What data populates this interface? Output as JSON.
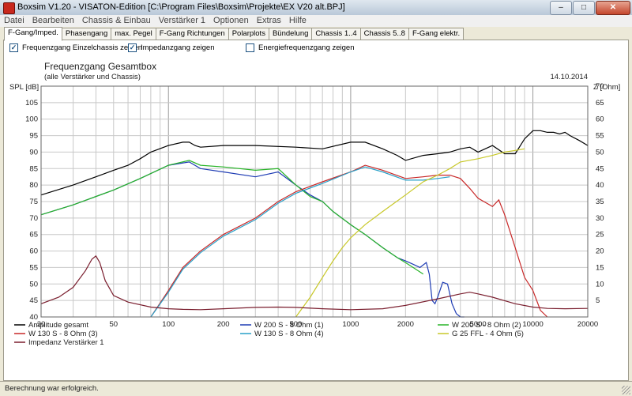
{
  "window": {
    "title": "Boxsim V1.20 - VISATON-Edition [C:\\Program Files\\Boxsim\\Projekte\\EX V20 alt.BPJ]",
    "minimize": "–",
    "maximize": "□",
    "close": "✕"
  },
  "menu": [
    "Datei",
    "Bearbeiten",
    "Chassis & Einbau",
    "Verstärker 1",
    "Optionen",
    "Extras",
    "Hilfe"
  ],
  "tabs": [
    {
      "label": "F-Gang/Imped.",
      "active": true
    },
    {
      "label": "Phasengang",
      "active": false
    },
    {
      "label": "max. Pegel",
      "active": false
    },
    {
      "label": "F-Gang Richtungen",
      "active": false
    },
    {
      "label": "Polarplots",
      "active": false
    },
    {
      "label": "Bündelung",
      "active": false
    },
    {
      "label": "Chassis 1..4",
      "active": false
    },
    {
      "label": "Chassis 5..8",
      "active": false
    },
    {
      "label": "F-Gang elektr.",
      "active": false
    }
  ],
  "checkboxes": [
    {
      "label": "Frequenzgang Einzelchassis zeigen",
      "checked": true
    },
    {
      "label": "Impedanzgang zeigen",
      "checked": true
    },
    {
      "label": "Energiefrequenzgang zeigen",
      "checked": false
    }
  ],
  "status": "Berechnung war erfolgreich.",
  "chart_data": {
    "type": "line",
    "title": "Frequenzgang Gesamtbox",
    "subtitle": "(alle Verstärker und Chassis)",
    "date": "14.10.2014",
    "ylabel": "SPL [dB]",
    "ylabel_right": "Z [Ohm]",
    "xscale": "log",
    "xlim": [
      20,
      20000
    ],
    "ylim": [
      40,
      110
    ],
    "ylim_right": [
      0,
      70
    ],
    "x_ticks": [
      20,
      50,
      100,
      200,
      500,
      1000,
      2000,
      5000,
      10000,
      20000
    ],
    "x_tick_labels": [
      "20",
      "50",
      "100",
      "200",
      "500",
      "1000",
      "2000",
      "5000",
      "10000",
      "20000"
    ],
    "y_ticks": [
      40,
      45,
      50,
      55,
      60,
      65,
      70,
      75,
      80,
      85,
      90,
      95,
      100,
      105,
      110
    ],
    "y_tick_labels": [
      "40",
      "45",
      "50",
      "55",
      "60",
      "65",
      "70",
      "75",
      "80",
      "85",
      "90",
      "95",
      "100",
      "105",
      ""
    ],
    "y_ticks_right": [
      5,
      10,
      15,
      20,
      25,
      30,
      35,
      40,
      45,
      50,
      55,
      60,
      65,
      70
    ],
    "y_tick_labels_right": [
      "5",
      "10",
      "15",
      "20",
      "25",
      "30",
      "35",
      "40",
      "45",
      "50",
      "55",
      "60",
      "65",
      "70"
    ],
    "grid": true,
    "legend_position": "bottom",
    "series": [
      {
        "name": "Amplitude gesamt",
        "color": "#000000",
        "axis": "left",
        "x": [
          20,
          30,
          40,
          50,
          60,
          70,
          80,
          100,
          120,
          130,
          140,
          150,
          200,
          300,
          500,
          700,
          1000,
          1200,
          1500,
          1800,
          2000,
          2500,
          3000,
          3500,
          4000,
          4500,
          5000,
          6000,
          7000,
          8000,
          9000,
          10000,
          11000,
          12000,
          13000,
          14000,
          15000,
          16000,
          18000,
          20000
        ],
        "y": [
          77,
          80,
          82.5,
          84.5,
          86,
          88,
          90,
          92,
          93,
          93,
          92,
          91.5,
          92,
          92,
          91.5,
          91,
          93,
          93,
          91,
          89,
          87.5,
          89,
          89.5,
          90,
          91,
          91.5,
          90,
          92,
          89.5,
          89.5,
          94,
          96.5,
          96.5,
          96,
          96,
          95.5,
          96,
          95,
          93.5,
          92
        ]
      },
      {
        "name": "W 200 S - 8 Ohm (1)",
        "color": "#1e3cb4",
        "axis": "left",
        "x": [
          20,
          30,
          50,
          70,
          100,
          130,
          150,
          200,
          300,
          400,
          500,
          600,
          700,
          800,
          1000,
          1200,
          1500,
          1800,
          2000,
          2200,
          2400,
          2600,
          2700,
          2800,
          2900,
          3000,
          3200,
          3400,
          3600,
          3800,
          4000,
          4200
        ],
        "y": [
          71,
          74,
          78.5,
          82,
          86,
          87,
          85,
          84,
          82.5,
          84,
          80,
          77,
          75,
          72,
          68,
          65,
          61,
          58,
          57,
          56,
          55,
          56.5,
          53,
          45,
          44,
          46,
          50.5,
          50,
          44,
          41,
          40,
          40
        ]
      },
      {
        "name": "W 200 S - 8 Ohm (2)",
        "color": "#28b428",
        "axis": "left",
        "x": [
          20,
          30,
          50,
          70,
          100,
          130,
          150,
          200,
          300,
          400,
          500,
          600,
          700,
          800,
          1000,
          1200,
          1500,
          1800,
          2000,
          2200,
          2500
        ],
        "y": [
          71,
          74,
          78.5,
          82,
          86,
          87.5,
          86,
          85.5,
          84.5,
          85,
          80,
          76.5,
          75,
          72,
          68,
          65,
          61,
          58,
          56.5,
          55,
          53
        ]
      },
      {
        "name": "W 130 S - 8 Ohm (3)",
        "color": "#c82828",
        "axis": "left",
        "x": [
          80,
          100,
          120,
          150,
          200,
          300,
          400,
          500,
          700,
          1000,
          1200,
          1500,
          2000,
          2500,
          3000,
          3500,
          4000,
          4500,
          5000,
          6000,
          6500,
          7000,
          8000,
          9000,
          10000,
          11000,
          12000
        ],
        "y": [
          40,
          48,
          55,
          60,
          65,
          70,
          75,
          78,
          81,
          84,
          86,
          84.5,
          82,
          82.5,
          83,
          83,
          82,
          79,
          76,
          73.5,
          75.5,
          71,
          61,
          52,
          48,
          42,
          40
        ]
      },
      {
        "name": "W 130 S - 8 Ohm (4)",
        "color": "#28a0c8",
        "axis": "left",
        "x": [
          80,
          100,
          120,
          150,
          200,
          300,
          400,
          500,
          700,
          1000,
          1200,
          1500,
          2000,
          2500,
          3000,
          3500
        ],
        "y": [
          40,
          47.5,
          54.5,
          59.5,
          64.5,
          69.5,
          74.5,
          77.5,
          80.5,
          84,
          85.5,
          84,
          81.5,
          81.5,
          82,
          82.5
        ]
      },
      {
        "name": "G 25 FFL - 4 Ohm (5)",
        "color": "#c8c828",
        "axis": "left",
        "x": [
          500,
          600,
          700,
          800,
          900,
          1000,
          1200,
          1500,
          2000,
          2500,
          3000,
          3500,
          4000,
          5000,
          6000,
          7000,
          8000,
          9000
        ],
        "y": [
          40,
          46,
          52,
          57,
          61,
          64,
          68,
          72,
          77,
          81,
          83,
          85,
          87,
          88,
          89,
          90,
          90.5,
          91
        ]
      },
      {
        "name": "Impedanz Verstärker 1",
        "color": "#7a1e2e",
        "axis": "right",
        "x": [
          20,
          25,
          30,
          35,
          38,
          40,
          42,
          45,
          50,
          60,
          80,
          100,
          120,
          150,
          200,
          300,
          400,
          500,
          700,
          1000,
          1500,
          2000,
          3000,
          4000,
          4500,
          5000,
          6000,
          8000,
          10000,
          12000,
          15000,
          20000
        ],
        "y": [
          4,
          6,
          9,
          14,
          17.5,
          18.5,
          16.5,
          11,
          6.5,
          4.5,
          3,
          2.5,
          2.3,
          2.2,
          2.5,
          2.9,
          3,
          2.9,
          2.5,
          2.2,
          2.5,
          3.5,
          5.5,
          7,
          7.5,
          7,
          6,
          4,
          3,
          2.6,
          2.5,
          2.6
        ]
      }
    ],
    "legend_columns": [
      [
        "Amplitude gesamt",
        "W 130 S - 8 Ohm (3)",
        "Impedanz Verstärker 1"
      ],
      [
        "W 200 S - 8 Ohm (1)",
        "W 130 S - 8 Ohm (4)"
      ],
      [
        "W 200 S - 8 Ohm (2)",
        "G 25 FFL - 4 Ohm (5)"
      ]
    ]
  }
}
